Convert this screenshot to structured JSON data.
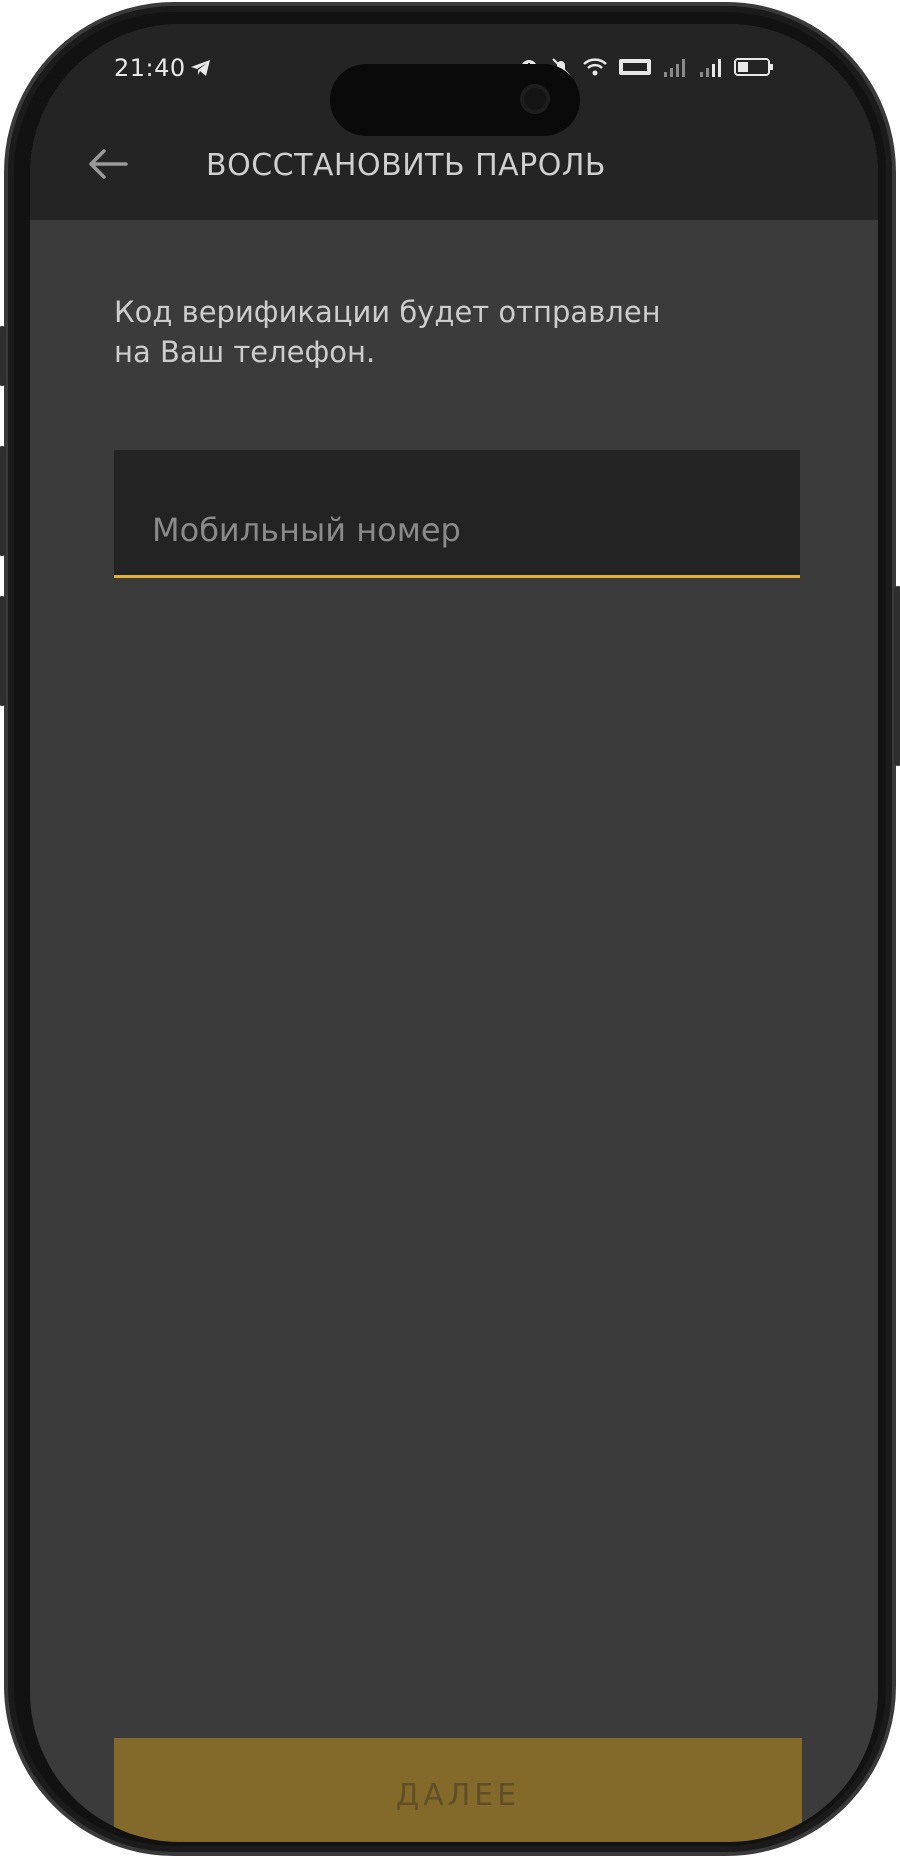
{
  "status_bar": {
    "time": "21:40",
    "icons": [
      "telegram-icon",
      "alarm-icon",
      "silent-icon",
      "wifi-icon",
      "volte-icon",
      "signal-icon",
      "signal-icon",
      "battery-icon"
    ]
  },
  "header": {
    "back_icon": "arrow-left-icon",
    "title": "ВОССТАНОВИТЬ ПАРОЛЬ"
  },
  "main": {
    "description_line1": "Код верификации будет отправлен",
    "description_line2": "на Ваш телефон.",
    "phone_input": {
      "value": "",
      "placeholder": "Мобильный номер"
    }
  },
  "footer": {
    "next_label": "ДАЛЕЕ"
  },
  "colors": {
    "background": "#3b3b3b",
    "header": "#242424",
    "accent": "#e2b13c",
    "button": "#846a2a"
  }
}
